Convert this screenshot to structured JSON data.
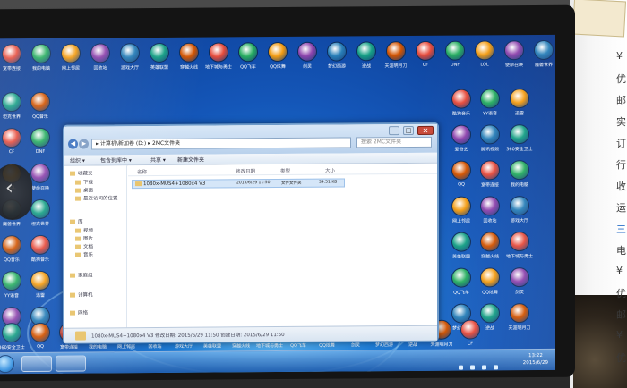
{
  "scene": "photo of a monitor showing a Windows 7 desktop with an open folder window",
  "colors": {
    "desktop_bg": "#1f7ed8",
    "window_frame": "#6d9ac9",
    "selection": "#d5e6f8",
    "taskbar": "#1e5aaa",
    "close_button": "#c94a3a",
    "folder": "#e8c36a"
  },
  "window": {
    "breadcrumb": "▸ 计算机\\新加卷 (D:) ▸ 2MC文件夹",
    "search_placeholder": "搜索 2MC文件夹",
    "toolbar": [
      "组织 ▾",
      "包含到库中 ▾",
      "共享 ▾",
      "新建文件夹"
    ],
    "nav": {
      "favorites": "收藏夹",
      "favorites_items": [
        "下载",
        "桌面",
        "最近访问的位置"
      ],
      "libraries": "库",
      "library_items": [
        "视频",
        "图片",
        "文档",
        "音乐"
      ],
      "homegroup": "家庭组",
      "computer": "计算机",
      "network": "网络"
    },
    "columns": [
      "名称",
      "修改日期",
      "类型",
      "大小"
    ],
    "file": {
      "name": "1080x-MUS4+1080x4 V3",
      "date": "2015/6/29 11:50",
      "type": "文件文件夹",
      "size": "34.51 KB"
    },
    "details": "1080x-MUS4+1080x4 V3  修改日期: 2015/6/29 11:50  创建日期: 2015/6/29 11:50"
  },
  "taskbar": {
    "clock_time": "13:22",
    "clock_date": "2015/6/29"
  },
  "desktop_icons": [
    "宽带连接",
    "我的电脑",
    "网上邻居",
    "回收站",
    "游戏大厅",
    "英雄联盟",
    "穿越火线",
    "地下城与勇士",
    "QQ飞车",
    "QQ炫舞",
    "剑灵",
    "梦幻西游",
    "逆战",
    "天涯明月刀",
    "CF",
    "DNF",
    "LOL",
    "使命召唤",
    "魔兽世界",
    "坦克世界",
    "QQ音乐",
    "酷狗音乐",
    "YY语音",
    "迅雷",
    "爱奇艺",
    "腾讯视频",
    "360安全卫士",
    "QQ"
  ],
  "side_text": [
    "¥",
    "优",
    "邮",
    "实",
    "订",
    "行",
    "收",
    "运",
    "三",
    "电",
    "¥",
    "优",
    "邮",
    "¥",
    "优"
  ]
}
